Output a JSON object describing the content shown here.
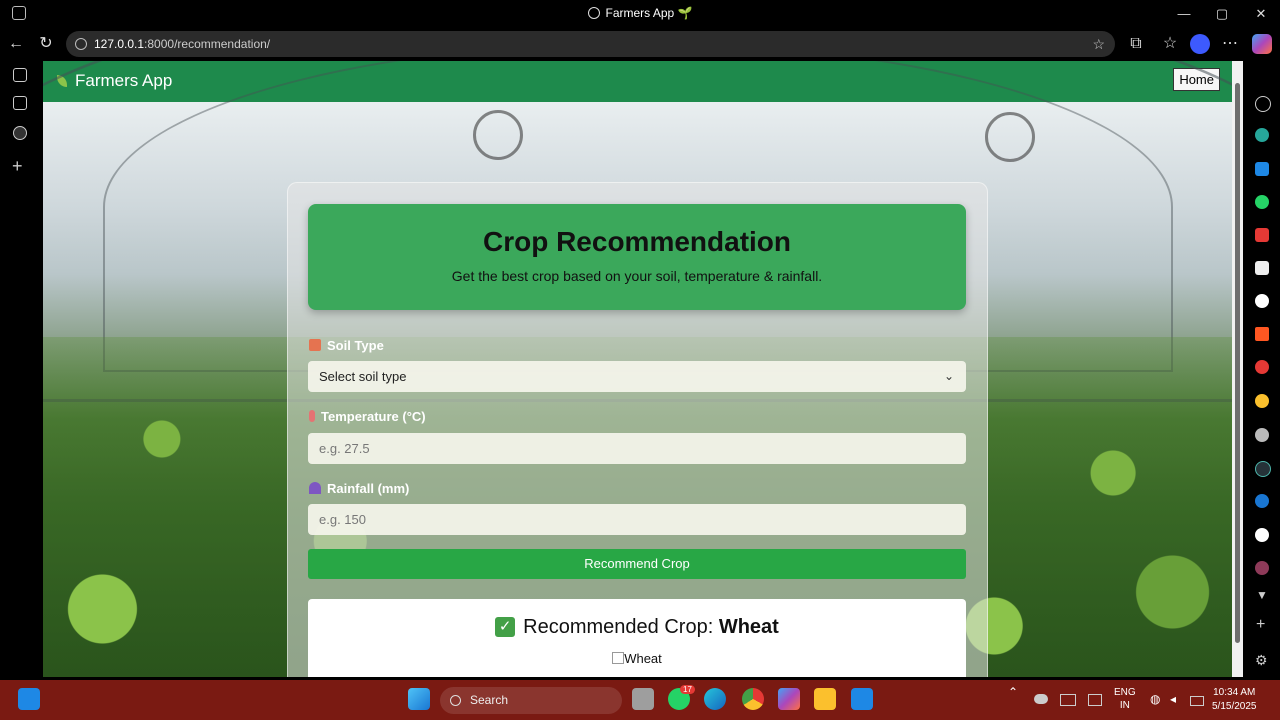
{
  "window": {
    "title": "Farmers App 🌱"
  },
  "browser": {
    "url_host": "127.0.0.1",
    "url_rest": ":8000/recommendation/"
  },
  "app": {
    "brand": "Farmers App",
    "home_label": "Home"
  },
  "hero": {
    "title": "Crop Recommendation",
    "subtitle": "Get the best crop based on your soil, temperature & rainfall."
  },
  "form": {
    "soil_label": "Soil Type",
    "soil_selected": "Select soil type",
    "temp_label": "Temperature (°C)",
    "temp_placeholder": "e.g. 27.5",
    "rain_label": "Rainfall (mm)",
    "rain_placeholder": "e.g. 150",
    "submit_label": "Recommend Crop"
  },
  "result": {
    "prefix": "Recommended Crop: ",
    "crop": "Wheat",
    "image_alt": "Wheat"
  },
  "taskbar": {
    "search_label": "Search",
    "whatsapp_badge": "17",
    "lang_line1": "ENG",
    "lang_line2": "IN",
    "time": "10:34 AM",
    "date": "5/15/2025"
  },
  "colors": {
    "app_bar": "#1e8a4c",
    "hero": "#3ba85b",
    "button": "#28a745",
    "taskbar": "#7a1a12"
  }
}
